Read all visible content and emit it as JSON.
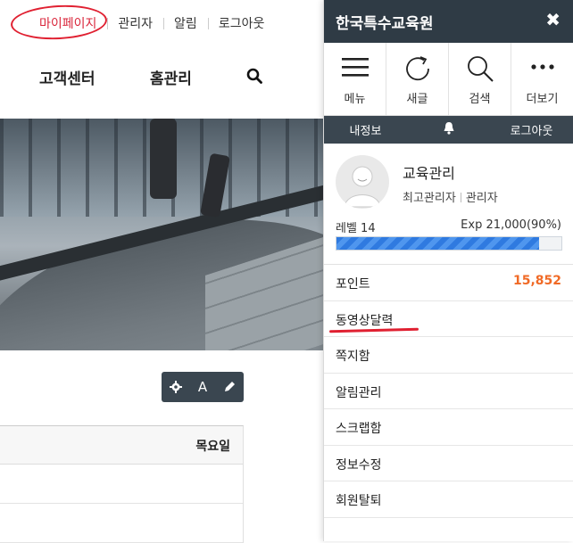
{
  "background_page": {
    "top_links": [
      "마이페이지",
      "관리자",
      "알림",
      "로그아웃"
    ],
    "nav": {
      "items": [
        "고객센터",
        "홈관리"
      ],
      "search_icon": "search-icon"
    },
    "toolbar": {
      "settings_icon": "gear-icon",
      "font_label": "A",
      "edit_icon": "pencil-icon"
    },
    "table": {
      "header_right": "목요일"
    }
  },
  "panel": {
    "title": "한국특수교육원",
    "close_label": "✖",
    "icon_buttons": [
      {
        "label": "메뉴",
        "icon": "menu-icon"
      },
      {
        "label": "새글",
        "icon": "refresh-icon"
      },
      {
        "label": "검색",
        "icon": "search-icon"
      },
      {
        "label": "더보기",
        "icon": "more-icon"
      }
    ],
    "subbar": {
      "info": "내정보",
      "bell_icon": "bell-icon",
      "logout": "로그아웃"
    },
    "profile": {
      "name": "교육관리",
      "role1": "최고관리자",
      "role2": "관리자",
      "level": "레벨 14",
      "exp": "Exp 21,000(90%)",
      "exp_fraction": 0.9
    },
    "menu": [
      {
        "label": "포인트",
        "value": "15,852"
      },
      {
        "label": "동영상달력"
      },
      {
        "label": "쪽지함"
      },
      {
        "label": "알림관리"
      },
      {
        "label": "스크랩함"
      },
      {
        "label": "정보수정"
      },
      {
        "label": "회원탈퇴"
      }
    ],
    "accent_color": "#f06a26"
  },
  "annotations": {
    "highlight_color": "#e02031"
  }
}
